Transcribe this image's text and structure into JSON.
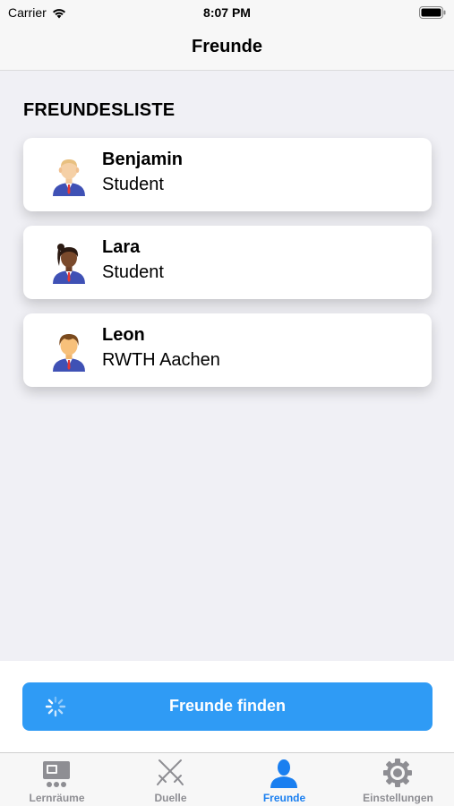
{
  "status_bar": {
    "carrier": "Carrier",
    "time": "8:07 PM"
  },
  "nav": {
    "title": "Freunde"
  },
  "section": {
    "header": "FREUNDESLISTE"
  },
  "friends": [
    {
      "name": "Benjamin",
      "subtitle": "Student",
      "avatar": "bald-man-avatar-icon"
    },
    {
      "name": "Lara",
      "subtitle": "Student",
      "avatar": "woman-ponytail-avatar-icon"
    },
    {
      "name": "Leon",
      "subtitle": "RWTH Aachen",
      "avatar": "brown-hair-man-avatar-icon"
    }
  ],
  "find_button": {
    "label": "Freunde finden",
    "loading": true
  },
  "tabs": [
    {
      "label": "Lernräume",
      "icon": "lernraeume-icon",
      "active": false
    },
    {
      "label": "Duelle",
      "icon": "crossed-swords-icon",
      "active": false
    },
    {
      "label": "Freunde",
      "icon": "person-icon",
      "active": true
    },
    {
      "label": "Einstellungen",
      "icon": "gear-icon",
      "active": false
    }
  ],
  "colors": {
    "accent": "#2f9bf5",
    "tab_active": "#1a7ff0",
    "tab_inactive": "#8e8e93",
    "background": "#f0f0f5"
  }
}
